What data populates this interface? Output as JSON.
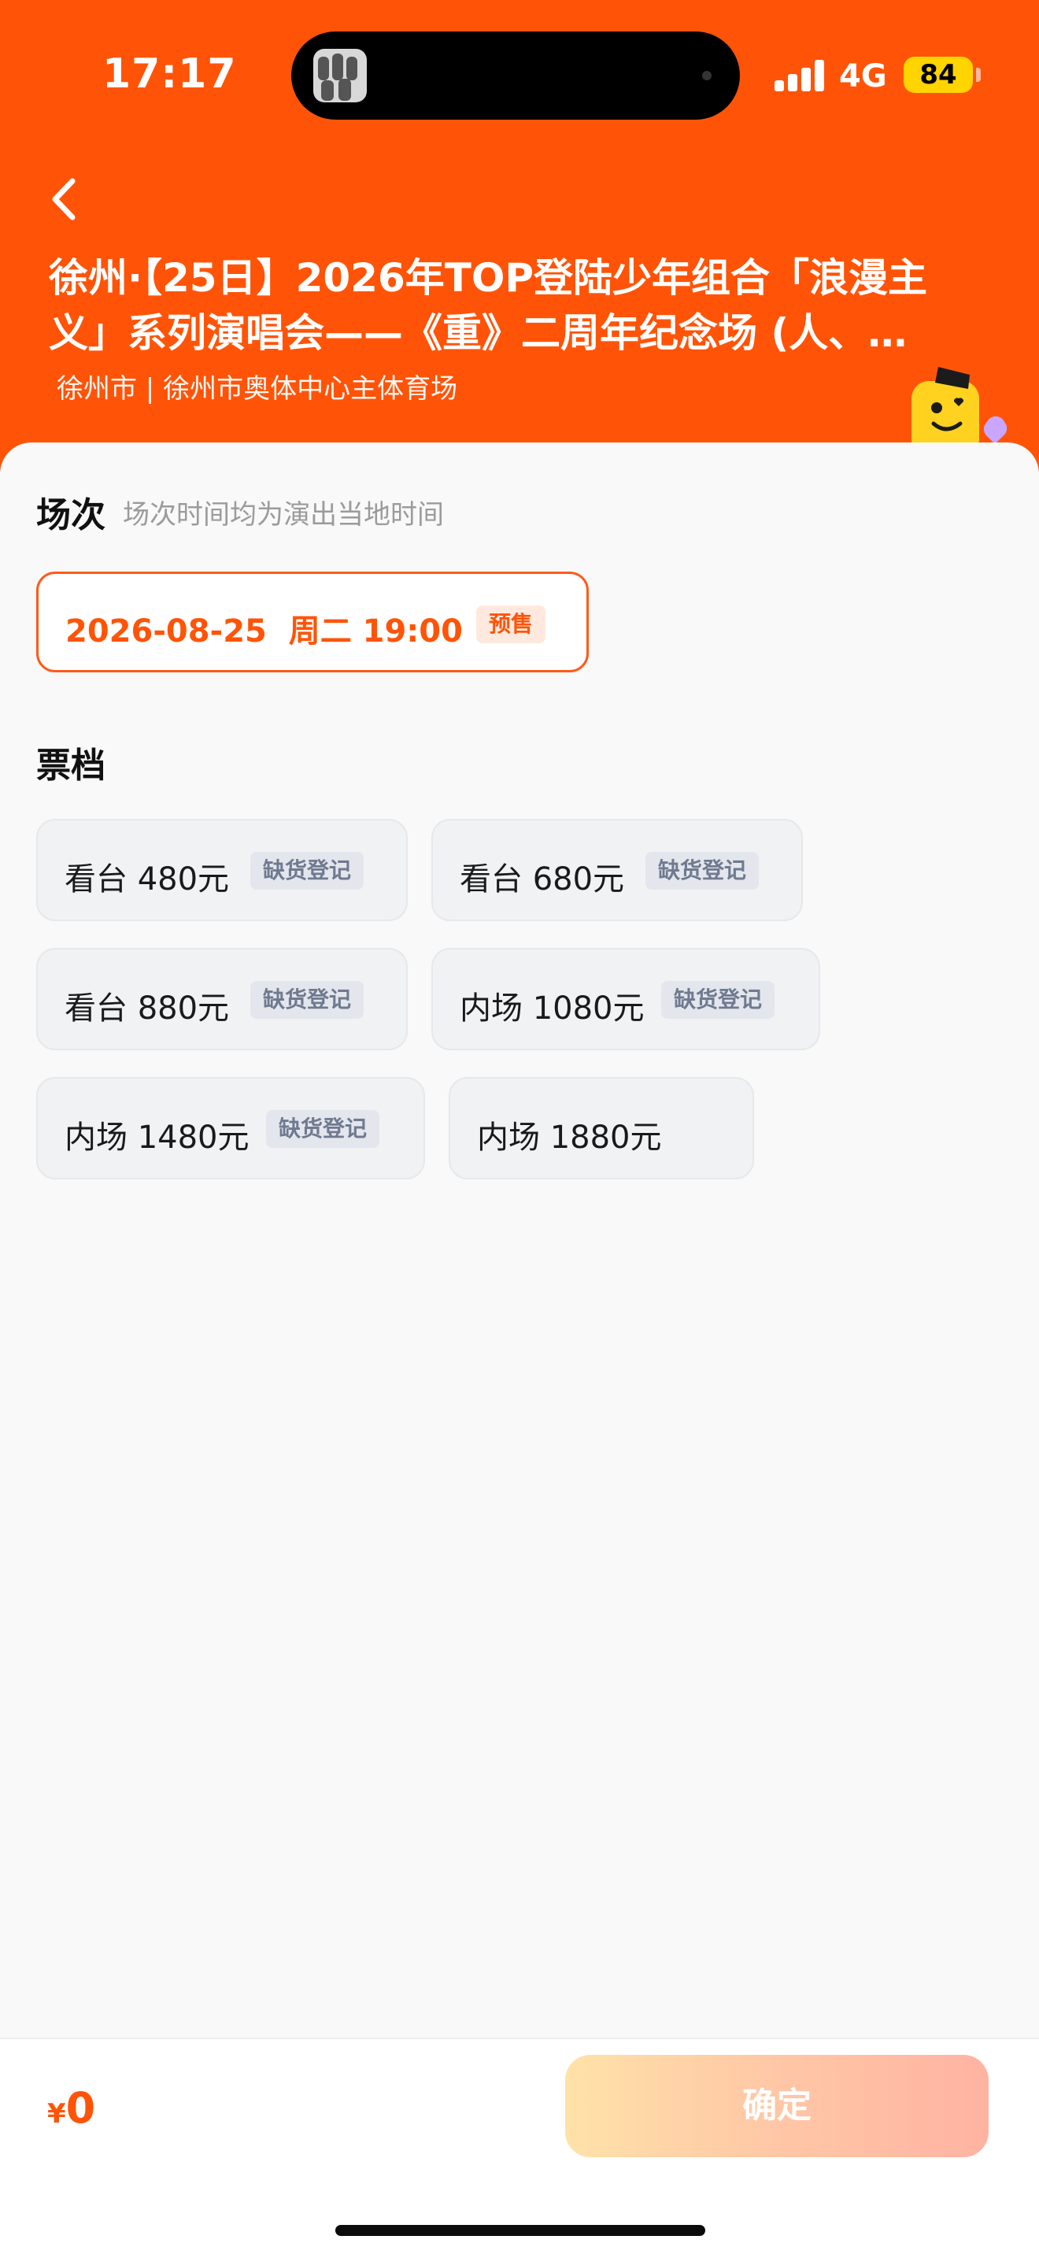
{
  "status_bar": {
    "time": "17:17",
    "network": "4G",
    "battery": "84"
  },
  "header": {
    "title": "徐州·【25日】2026年TOP登陆少年组合「浪漫主义」系列演唱会——《重》二周年纪念场 (人、…",
    "venue": "徐州市 | 徐州市奥体中心主体育场"
  },
  "session": {
    "heading": "场次",
    "hint": "场次时间均为演出当地时间",
    "selected": "2026-08-25  周二 19:00",
    "badge": "预售"
  },
  "tiers": {
    "heading": "票档",
    "items": [
      {
        "label": "看台 480元",
        "badge": "缺货登记"
      },
      {
        "label": "看台 680元",
        "badge": "缺货登记"
      },
      {
        "label": "看台 880元",
        "badge": "缺货登记"
      },
      {
        "label": "内场 1080元",
        "badge": "缺货登记"
      },
      {
        "label": "内场 1480元",
        "badge": "缺货登记"
      },
      {
        "label": "内场 1880元",
        "badge": ""
      }
    ]
  },
  "footer": {
    "currency": "¥",
    "total": "0",
    "confirm_label": "确定"
  },
  "colors": {
    "brand": "#ff5408",
    "card_bg": "#f1f2f4",
    "badge_text": "#6f7a90"
  }
}
